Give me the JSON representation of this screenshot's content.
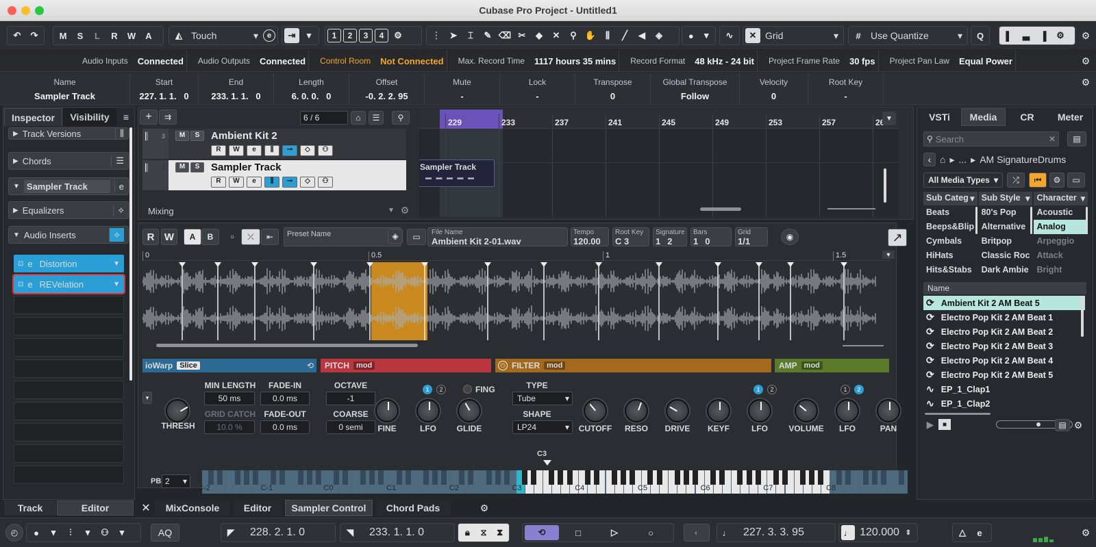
{
  "window": {
    "title": "Cubase Pro Project - Untitled1"
  },
  "toolbar": {
    "states": [
      "M",
      "S",
      "L",
      "R",
      "W",
      "A"
    ],
    "automation_mode": "Touch",
    "nums": [
      "1",
      "2",
      "3",
      "4"
    ],
    "snap_type": "Grid",
    "quantize": "Use Quantize"
  },
  "status": [
    {
      "label": "Audio Inputs",
      "value": "Connected"
    },
    {
      "label": "Audio Outputs",
      "value": "Connected"
    },
    {
      "label": "Control Room",
      "value": "Not Connected",
      "accent": "#f4a62a"
    },
    {
      "label": "Max. Record Time",
      "value": "1117 hours 35 mins"
    },
    {
      "label": "Record Format",
      "value": "48 kHz - 24 bit"
    },
    {
      "label": "Project Frame Rate",
      "value": "30 fps"
    },
    {
      "label": "Project Pan Law",
      "value": "Equal Power"
    }
  ],
  "infoline": [
    {
      "h": "Name",
      "v": "Sampler Track"
    },
    {
      "h": "Start",
      "v": "227. 1. 1.   0"
    },
    {
      "h": "End",
      "v": "233. 1. 1.   0"
    },
    {
      "h": "Length",
      "v": "6. 0. 0.   0"
    },
    {
      "h": "Offset",
      "v": "-0. 2. 2. 95"
    },
    {
      "h": "Mute",
      "v": "-"
    },
    {
      "h": "Lock",
      "v": "-"
    },
    {
      "h": "Transpose",
      "v": "0"
    },
    {
      "h": "Global Transpose",
      "v": "Follow"
    },
    {
      "h": "Velocity",
      "v": "0"
    },
    {
      "h": "Root Key",
      "v": "-"
    }
  ],
  "inspector": {
    "tabs": [
      "Inspector",
      "Visibility"
    ],
    "sections": [
      "Track Versions",
      "Chords",
      "Sampler Track",
      "Equalizers",
      "Audio Inserts"
    ],
    "inserts": [
      "Distortion",
      "REVelation"
    ],
    "bottom_tabs": [
      "Track",
      "Editor"
    ]
  },
  "project": {
    "track_count": "6 / 6",
    "tracks": [
      {
        "num": "3",
        "name": "Ambient Kit 2"
      },
      {
        "num": "4",
        "name": "Sampler Track"
      }
    ],
    "mixing_label": "Mixing",
    "ruler": [
      "229",
      "233",
      "237",
      "241",
      "245",
      "249",
      "253",
      "257",
      "26"
    ],
    "event_name": "Sampler Track"
  },
  "sampler": {
    "rw": [
      "R",
      "W"
    ],
    "ab": [
      "A",
      "B"
    ],
    "preset_placeholder": "Preset Name",
    "file_label": "File Name",
    "file_name": "Ambient Kit 2-01.wav",
    "tempo_label": "Tempo",
    "tempo": "120.00",
    "rootkey_label": "Root Key",
    "rootkey": "C  3",
    "sig_label": "Signature",
    "sig_num": "1",
    "sig_den": "2",
    "bars_label": "Bars",
    "bars": "1",
    "beats_label": "Beats",
    "beats": "0",
    "grid_label": "Grid",
    "grid": "1/1",
    "ruler": [
      "0",
      "0.5",
      "1",
      "1.5"
    ],
    "sections": {
      "warp": {
        "title": "ioWarp",
        "mode": "Slice",
        "min_length_label": "MIN LENGTH",
        "min_length": "50 ms",
        "fade_in_label": "FADE-IN",
        "fade_in": "0.0 ms",
        "grid_catch_label": "GRID CATCH",
        "grid_catch": "10.0 %",
        "fade_out_label": "FADE-OUT",
        "fade_out": "0.0 ms",
        "thresh": "THRESH"
      },
      "pitch": {
        "title": "PITCH",
        "mod": "mod",
        "octave_label": "OCTAVE",
        "octave": "-1",
        "coarse_label": "COARSE",
        "coarse": "0 semi",
        "fing": "FING",
        "knobs": [
          "FINE",
          "LFO",
          "GLIDE"
        ]
      },
      "filter": {
        "title": "FILTER",
        "mod": "mod",
        "type_label": "TYPE",
        "type": "Tube",
        "shape_label": "SHAPE",
        "shape": "LP24",
        "knobs": [
          "CUTOFF",
          "RESO",
          "DRIVE",
          "KEYF",
          "LFO"
        ]
      },
      "amp": {
        "title": "AMP",
        "mod": "mod",
        "knobs": [
          "VOLUME",
          "LFO",
          "PAN"
        ]
      }
    },
    "pb_label": "PB",
    "pb_value": "2",
    "keyboard_marker": "C3",
    "octaves": [
      "C-2",
      "C-1",
      "C0",
      "C1",
      "C2",
      "C3",
      "C4",
      "C5",
      "C6",
      "C7",
      "C8"
    ]
  },
  "lower_tabs": [
    "MixConsole",
    "Editor",
    "Sampler Control",
    "Chord Pads"
  ],
  "media": {
    "tabs": [
      "VSTi",
      "Media",
      "CR",
      "Meter"
    ],
    "search_placeholder": "Search",
    "path_dots": "...",
    "path": "AM SignatureDrums",
    "media_type": "All Media Types",
    "columns": [
      {
        "header": "Sub Categ",
        "items": [
          "Beats",
          "Beeps&Blip",
          "Cymbals",
          "HiHats",
          "Hits&Stabs"
        ]
      },
      {
        "header": "Sub Style",
        "items": [
          "80's Pop",
          "Alternative",
          "Britpop",
          "Classic Roc",
          "Dark Ambie"
        ]
      },
      {
        "header": "Character",
        "items": [
          "Acoustic",
          "Analog",
          "Arpeggio",
          "Attack",
          "Bright"
        ]
      }
    ],
    "name_header": "Name",
    "files": [
      {
        "name": "Ambient Kit 2 AM Beat 5",
        "type": "loop",
        "selected": true
      },
      {
        "name": "Electro Pop Kit 2 AM Beat 1",
        "type": "loop"
      },
      {
        "name": "Electro Pop Kit 2 AM Beat 2",
        "type": "loop"
      },
      {
        "name": "Electro Pop Kit 2 AM Beat 3",
        "type": "loop"
      },
      {
        "name": "Electro Pop Kit 2 AM Beat 4",
        "type": "loop"
      },
      {
        "name": "Electro Pop Kit 2 AM Beat 5",
        "type": "loop"
      },
      {
        "name": "EP_1_Clap1",
        "type": "wave"
      },
      {
        "name": "EP_1_Clap2",
        "type": "wave"
      }
    ]
  },
  "transport": {
    "aq": "AQ",
    "left_locator": "228.  2.  1.    0",
    "right_locator": "233.  1.  1.    0",
    "position": "227.  3.  3.  95",
    "tempo": "120.000"
  },
  "colors": {
    "accent_blue": "#2a9fd6",
    "orange": "#f4a62a",
    "pitch": "#b9363f",
    "filter": "#a36a1e",
    "amp": "#5b7a2a",
    "warp": "#2c6a93",
    "selection": "#c9891f"
  }
}
